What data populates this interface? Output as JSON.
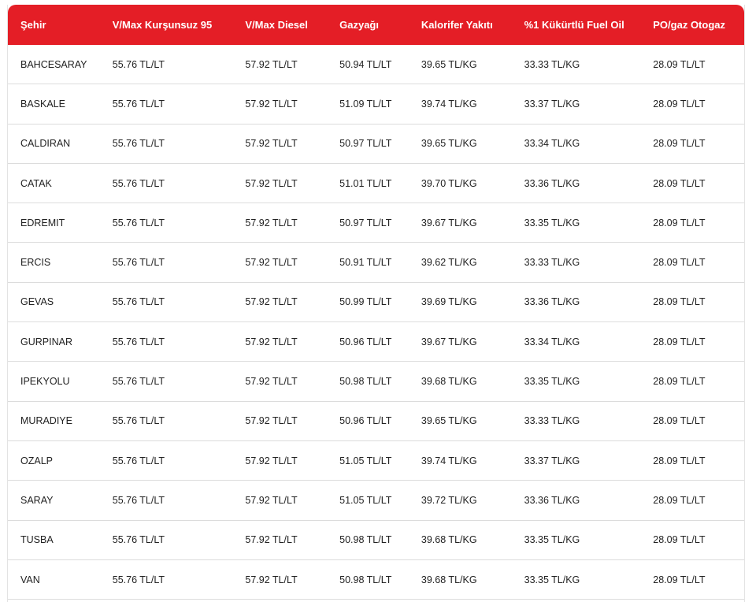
{
  "table": {
    "headers": [
      "Şehir",
      "V/Max Kurşunsuz 95",
      "V/Max Diesel",
      "Gazyağı",
      "Kalorifer Yakıtı",
      "%1 Kükürtlü Fuel Oil",
      "PO/gaz Otogaz"
    ],
    "rows": [
      [
        "BAHCESARAY",
        "55.76 TL/LT",
        "57.92 TL/LT",
        "50.94 TL/LT",
        "39.65 TL/KG",
        "33.33 TL/KG",
        "28.09 TL/LT"
      ],
      [
        "BASKALE",
        "55.76 TL/LT",
        "57.92 TL/LT",
        "51.09 TL/LT",
        "39.74 TL/KG",
        "33.37 TL/KG",
        "28.09 TL/LT"
      ],
      [
        "CALDIRAN",
        "55.76 TL/LT",
        "57.92 TL/LT",
        "50.97 TL/LT",
        "39.65 TL/KG",
        "33.34 TL/KG",
        "28.09 TL/LT"
      ],
      [
        "CATAK",
        "55.76 TL/LT",
        "57.92 TL/LT",
        "51.01 TL/LT",
        "39.70 TL/KG",
        "33.36 TL/KG",
        "28.09 TL/LT"
      ],
      [
        "EDREMIT",
        "55.76 TL/LT",
        "57.92 TL/LT",
        "50.97 TL/LT",
        "39.67 TL/KG",
        "33.35 TL/KG",
        "28.09 TL/LT"
      ],
      [
        "ERCIS",
        "55.76 TL/LT",
        "57.92 TL/LT",
        "50.91 TL/LT",
        "39.62 TL/KG",
        "33.33 TL/KG",
        "28.09 TL/LT"
      ],
      [
        "GEVAS",
        "55.76 TL/LT",
        "57.92 TL/LT",
        "50.99 TL/LT",
        "39.69 TL/KG",
        "33.36 TL/KG",
        "28.09 TL/LT"
      ],
      [
        "GURPINAR",
        "55.76 TL/LT",
        "57.92 TL/LT",
        "50.96 TL/LT",
        "39.67 TL/KG",
        "33.34 TL/KG",
        "28.09 TL/LT"
      ],
      [
        "IPEKYOLU",
        "55.76 TL/LT",
        "57.92 TL/LT",
        "50.98 TL/LT",
        "39.68 TL/KG",
        "33.35 TL/KG",
        "28.09 TL/LT"
      ],
      [
        "MURADIYE",
        "55.76 TL/LT",
        "57.92 TL/LT",
        "50.96 TL/LT",
        "39.65 TL/KG",
        "33.33 TL/KG",
        "28.09 TL/LT"
      ],
      [
        "OZALP",
        "55.76 TL/LT",
        "57.92 TL/LT",
        "51.05 TL/LT",
        "39.74 TL/KG",
        "33.37 TL/KG",
        "28.09 TL/LT"
      ],
      [
        "SARAY",
        "55.76 TL/LT",
        "57.92 TL/LT",
        "51.05 TL/LT",
        "39.72 TL/KG",
        "33.36 TL/KG",
        "28.09 TL/LT"
      ],
      [
        "TUSBA",
        "55.76 TL/LT",
        "57.92 TL/LT",
        "50.98 TL/LT",
        "39.68 TL/KG",
        "33.35 TL/KG",
        "28.09 TL/LT"
      ],
      [
        "VAN",
        "55.76 TL/LT",
        "57.92 TL/LT",
        "50.98 TL/LT",
        "39.68 TL/KG",
        "33.35 TL/KG",
        "28.09 TL/LT"
      ]
    ]
  },
  "colors": {
    "header_background": "#e41e26",
    "header_text": "#ffffff",
    "row_text": "#222222",
    "row_divider": "#dcdcdc"
  }
}
